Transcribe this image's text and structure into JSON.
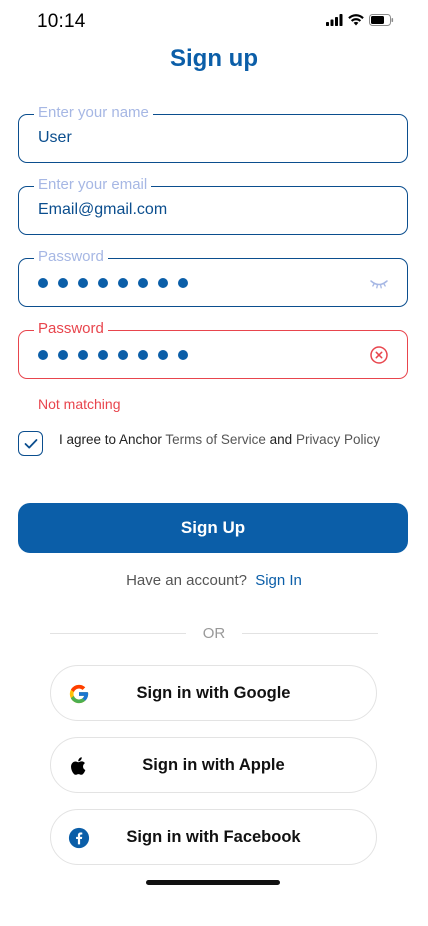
{
  "status": {
    "time": "10:14"
  },
  "title": "Sign up",
  "form": {
    "name": {
      "label": "Enter your name",
      "value": "User"
    },
    "email": {
      "label": "Enter your email",
      "value": "Email@gmail.com"
    },
    "password": {
      "label": "Password",
      "masked_length": 8
    },
    "confirm_password": {
      "label": "Password",
      "masked_length": 8,
      "error": "Not matching"
    }
  },
  "agree": {
    "checked": true,
    "prefix": "I agree to Anchor",
    "terms": "Terms of Service",
    "and": "and",
    "privacy": "Privacy Policy"
  },
  "submit_label": "Sign Up",
  "have_account": {
    "text": "Have an account?",
    "link": "Sign In"
  },
  "divider_text": "OR",
  "social": {
    "google": "Sign in with Google",
    "apple": "Sign in with Apple",
    "facebook": "Sign in with Facebook"
  },
  "colors": {
    "primary": "#0B5EA8",
    "error": "#E8454D",
    "label": "#A6B7E4"
  },
  "icons": {
    "password_toggle": "eye-closed-icon",
    "error": "error-circle-x-icon",
    "checkbox": "checkmark-icon",
    "google": "google-logo-icon",
    "apple": "apple-logo-icon",
    "facebook": "facebook-logo-icon"
  }
}
